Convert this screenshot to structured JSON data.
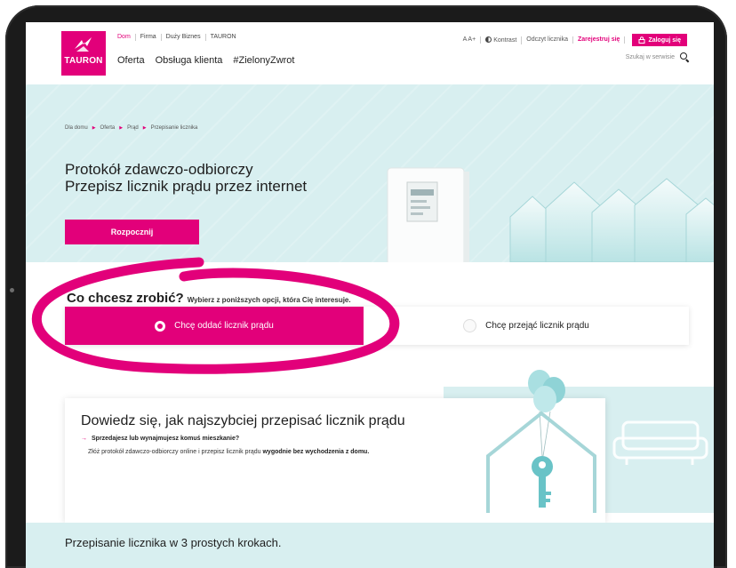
{
  "brand": {
    "logo_text": "TAURON",
    "accent_color": "#e2007a",
    "hero_bg_color": "#d8eff0"
  },
  "header": {
    "segments": [
      "Dom",
      "Firma",
      "Duży Biznes",
      "TAURON"
    ],
    "nav": [
      "Oferta",
      "Obsługa klienta",
      "#ZielonyZwrot"
    ],
    "font_size_toggle": "A A+",
    "contrast_label": "Kontrast",
    "meter_reading_link": "Odczyt licznika",
    "register_link": "Zarejestruj się",
    "login_button": "Zaloguj się",
    "search_placeholder": "Szukaj w serwisie"
  },
  "breadcrumb": [
    "Dla domu",
    "Oferta",
    "Prąd",
    "Przepisanie licznika"
  ],
  "hero": {
    "title_line1": "Protokół zdawczo-odbiorczy",
    "title_line2": "Przepisz licznik prądu przez internet",
    "start_button": "Rozpocznij"
  },
  "choice": {
    "title": "Co chcesz zrobić?",
    "subtitle": "Wybierz z poniższych opcji, która Cię interesuje.",
    "options": [
      {
        "label": "Chcę oddać licznik prądu",
        "selected": true
      },
      {
        "label": "Chcę przejąć licznik prądu",
        "selected": false
      }
    ]
  },
  "info": {
    "title": "Dowiedz się, jak najszybciej przepisać licznik prądu",
    "question": "Sprzedajesz lub wynajmujesz komuś mieszkanie?",
    "desc_normal": "Złóż protokół zdawczo-odbiorczy online i przepisz licznik prądu ",
    "desc_bold": "wygodnie bez wychodzenia z domu."
  },
  "steps": {
    "title": "Przepisanie licznika w 3 prostych krokach."
  },
  "icons": [
    "search-icon",
    "lock-icon",
    "contrast-icon",
    "arrow-right-icon",
    "radio-selected-icon",
    "radio-empty-icon",
    "key-icon",
    "house-icon",
    "sofa-icon",
    "balloon-icon",
    "electricity-meter-icon"
  ]
}
